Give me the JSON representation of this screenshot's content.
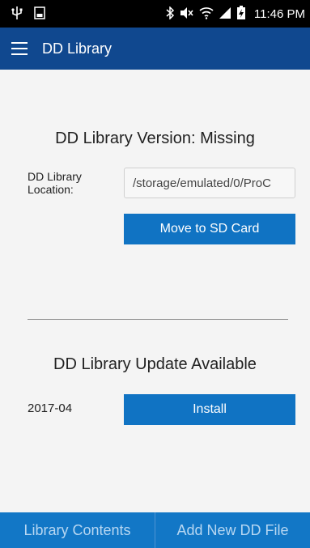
{
  "status_bar": {
    "time": "11:46 PM",
    "left_icons": [
      "usb-icon",
      "sd-card-icon"
    ],
    "right_icons": [
      "bluetooth-icon",
      "mute-icon",
      "wifi-icon",
      "signal-icon",
      "battery-charging-icon"
    ]
  },
  "app_bar": {
    "title": "DD Library"
  },
  "library": {
    "version_title": "DD Library Version: Missing",
    "location_label": "DD Library Location:",
    "location_value": "/storage/emulated/0/ProC",
    "move_button": "Move to SD Card"
  },
  "update": {
    "title": "DD Library Update Available",
    "version": "2017-04",
    "install_button": "Install"
  },
  "bottom_bar": {
    "tabs": [
      "Library Contents",
      "Add New DD File"
    ]
  }
}
